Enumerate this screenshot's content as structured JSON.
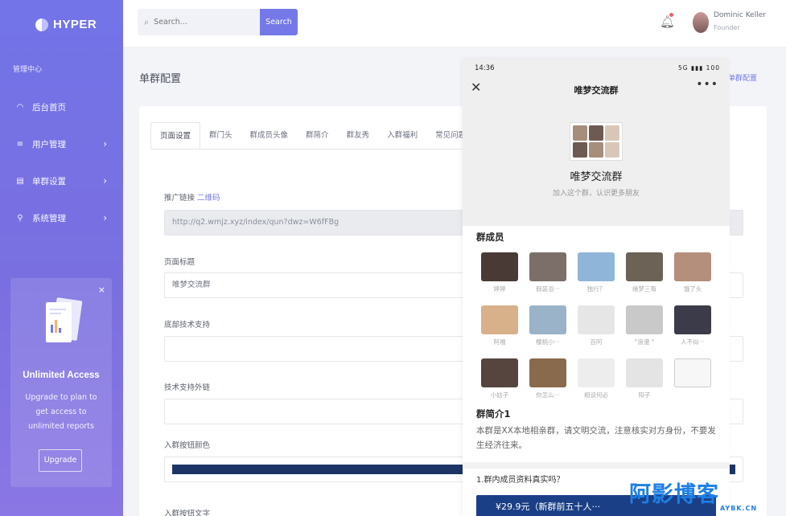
{
  "app": {
    "name": "HYPER"
  },
  "sidebar": {
    "section_title": "管理中心",
    "items": [
      {
        "label": "后台首页",
        "icon": "dashboard-icon",
        "has_arrow": false
      },
      {
        "label": "用户管理",
        "icon": "list-icon",
        "has_arrow": true
      },
      {
        "label": "单群设置",
        "icon": "grid-icon",
        "has_arrow": true
      },
      {
        "label": "系统管理",
        "icon": "location-pin-icon",
        "has_arrow": true
      }
    ],
    "arrow": "›",
    "promo": {
      "title": "Unlimited Access",
      "text": "Upgrade to plan to get access to unlimited reports",
      "button": "Upgrade",
      "close": "×"
    }
  },
  "topbar": {
    "search": {
      "placeholder": "Search...",
      "button": "Search"
    },
    "user": {
      "name": "Dominic Keller",
      "role": "Founder"
    }
  },
  "page": {
    "title": "单群配置",
    "breadcrumb": "单群配置",
    "tabs": [
      "页面设置",
      "群门头",
      "群成员头像",
      "群简介",
      "群友秀",
      "入群福利",
      "常见问题"
    ],
    "active_tab": 0,
    "form": {
      "promo_link_label": "推广链接",
      "promo_link_qr": "二维码",
      "promo_link_value": "http://q2.wmjz.xyz/index/qun?dwz=W6fFBg",
      "page_title_label": "页面标题",
      "page_title_value": "唯梦交流群",
      "footer_support_label": "底部技术支持",
      "footer_support_value": "",
      "support_link_label": "技术支持外链",
      "support_link_value": "",
      "button_color_label": "入群按钮颜色",
      "button_color_value": "#1c3566",
      "button_text_label": "入群按钮文字"
    }
  },
  "phone": {
    "time": "14:36",
    "status_right": "5G ▮▮▮ 100",
    "close": "✕",
    "more": "•••",
    "title": "唯梦交流群",
    "group_name": "唯梦交流群",
    "group_sub": "加入这个群，认识更多朋友",
    "members_title": "群成员",
    "members": [
      {
        "name": "婷婷",
        "color": "#4a3a36"
      },
      {
        "name": "假装浴···",
        "color": "#7c6f6a"
      },
      {
        "name": "独行？",
        "color": "#8fb6d8"
      },
      {
        "name": "缘梦三每",
        "color": "#6c6255"
      },
      {
        "name": "饿了头",
        "color": "#b48f7c"
      },
      {
        "name": "阿福",
        "color": "#d8b08a"
      },
      {
        "name": "樱桃小···",
        "color": "#9ab3c8"
      },
      {
        "name": "百阿",
        "color": "#e6e6e6"
      },
      {
        "name": "°浪漫 °",
        "color": "#c9c9c9"
      },
      {
        "name": "人不似···",
        "color": "#3b3b4a"
      },
      {
        "name": "小姑子",
        "color": "#56453f"
      },
      {
        "name": "你怎么···",
        "color": "#8a6a4c"
      },
      {
        "name": "相谈何必",
        "color": "#ededed"
      },
      {
        "name": "阳子",
        "color": "#e4e4e4"
      },
      {
        "name": "",
        "color": "#f7f7f7"
      }
    ],
    "intro_title": "群简介1",
    "intro_text": "本群是XX本地相亲群，请文明交流，注意核实对方身份，不要发生经济往来。",
    "faq_question": "1.群内成员资料真实吗？",
    "join_button": "¥29.9元（新群前五十人···"
  },
  "watermark": {
    "main": "阿影博客",
    "sub": "AYBK.CN"
  },
  "colors": {
    "accent": "#7579e7",
    "sidebar": "#7274e8",
    "join": "#1b3f86",
    "watermark": "#1e7fe6"
  }
}
